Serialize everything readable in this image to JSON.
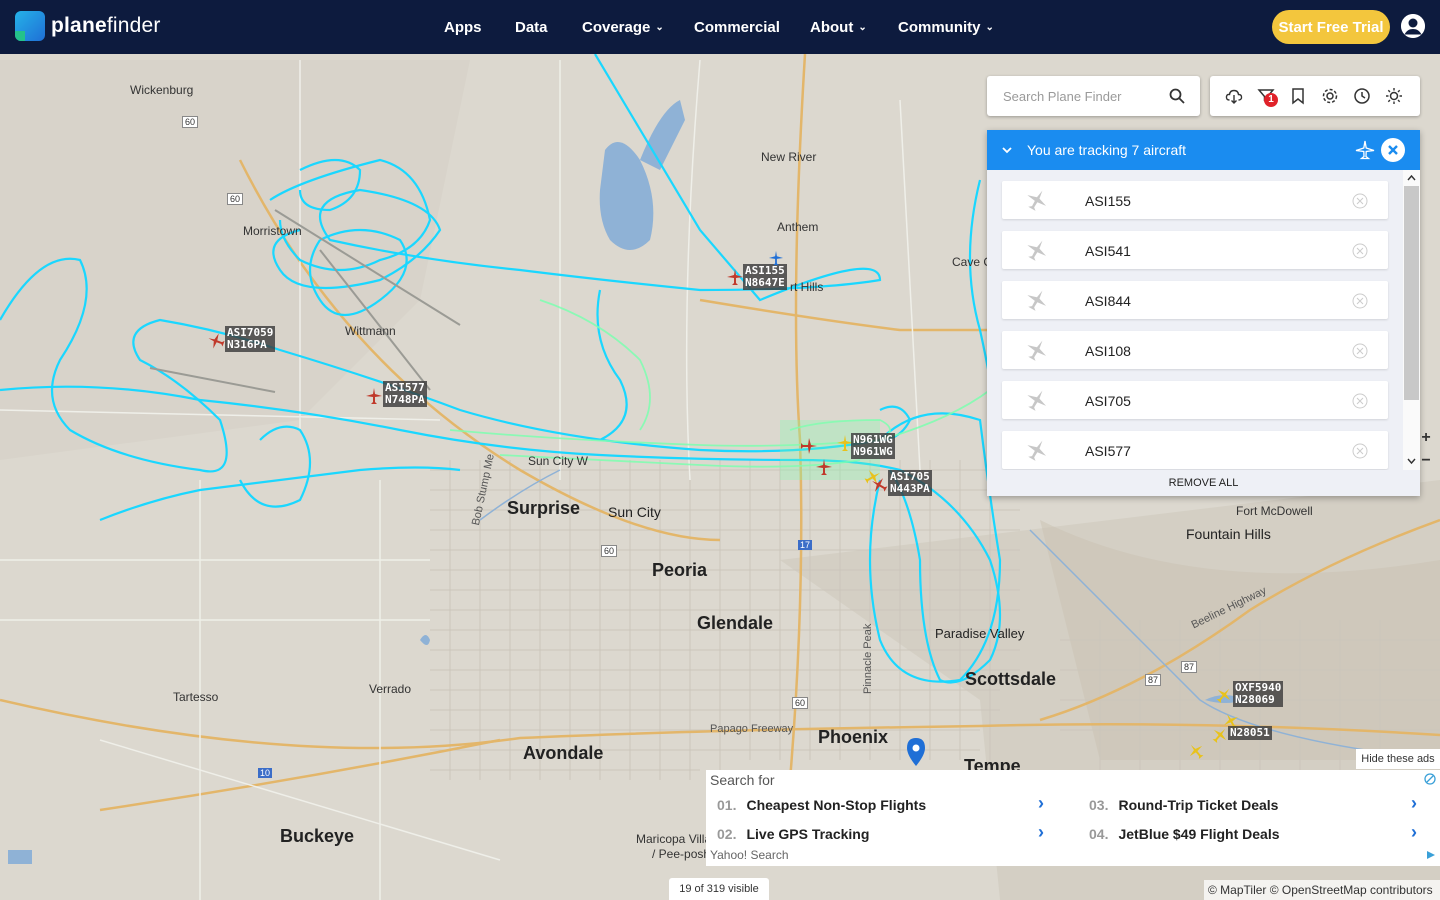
{
  "brand": {
    "name_bold": "plane",
    "name_rest": "finder"
  },
  "nav": {
    "apps": "Apps",
    "data": "Data",
    "coverage": "Coverage",
    "commercial": "Commercial",
    "about": "About",
    "community": "Community"
  },
  "cta": {
    "trial_label": "Start Free Trial"
  },
  "colors": {
    "topbar": "#0d1b3e",
    "accent": "#1a8cf0",
    "trial": "#f3c63d",
    "track_cyan": "#1ad7ff",
    "track_green": "#7dffb0"
  },
  "search": {
    "placeholder": "Search Plane Finder"
  },
  "toolbar": {
    "filter_badge": "1",
    "icons": [
      "cloud-icon",
      "filter-icon",
      "bookmark-icon",
      "settings-icon",
      "history-icon",
      "weather-icon"
    ]
  },
  "tracking": {
    "title": "You are tracking 7 aircraft",
    "items": [
      {
        "callsign": "ASI155"
      },
      {
        "callsign": "ASI541"
      },
      {
        "callsign": "ASI844"
      },
      {
        "callsign": "ASI108"
      },
      {
        "callsign": "ASI705"
      },
      {
        "callsign": "ASI577"
      }
    ],
    "remove_all": "REMOVE ALL"
  },
  "map": {
    "places": [
      {
        "name": "Wickenburg"
      },
      {
        "name": "Morristown"
      },
      {
        "name": "Wittmann"
      },
      {
        "name": "New River"
      },
      {
        "name": "Anthem"
      },
      {
        "name": "Cave C"
      },
      {
        "name": "rt Hills"
      },
      {
        "name": "Surprise"
      },
      {
        "name": "Sun City"
      },
      {
        "name": "Peoria"
      },
      {
        "name": "Glendale"
      },
      {
        "name": "Fort McDowell"
      },
      {
        "name": "Fountain Hills"
      },
      {
        "name": "Paradise Valley"
      },
      {
        "name": "Scottsdale"
      },
      {
        "name": "Phoenix"
      },
      {
        "name": "Tempe"
      },
      {
        "name": "Tartesso"
      },
      {
        "name": "Verrado"
      },
      {
        "name": "Avondale"
      },
      {
        "name": "Buckeye"
      },
      {
        "name": "Maricopa Villa"
      },
      {
        "name": "/ Pee-posh"
      },
      {
        "name": "Papago Freeway"
      },
      {
        "name": "Bob Stump Me"
      },
      {
        "name": "Beeline Highway"
      },
      {
        "name": "Pinnacle Peak"
      },
      {
        "name": "Sun City W"
      }
    ],
    "road_shields": [
      "60",
      "60",
      "17",
      "60",
      "87",
      "87",
      "10",
      "60"
    ],
    "aircraft_tags": [
      {
        "line1": "ASI155",
        "line2": "N8647E"
      },
      {
        "line1": "ASI7059",
        "line2": "N316PA"
      },
      {
        "line1": "ASI577",
        "line2": "N748PA"
      },
      {
        "line1": "N961WG",
        "line2": "N961WG"
      },
      {
        "line1": "ASI705",
        "line2": "N443PA"
      },
      {
        "line1": "OXF5940",
        "line2": "N28069"
      },
      {
        "line1": "N28051",
        "line2": ""
      }
    ],
    "visible_count": "19 of 319 visible",
    "attribution": "© MapTiler © OpenStreetMap contributors"
  },
  "ad": {
    "search_for": "Search for",
    "hide_ads": "Hide these ads",
    "items": [
      {
        "num": "01.",
        "label": "Cheapest Non-Stop Flights"
      },
      {
        "num": "02.",
        "label": "Live GPS Tracking"
      },
      {
        "num": "03.",
        "label": "Round-Trip Ticket Deals"
      },
      {
        "num": "04.",
        "label": "JetBlue $49 Flight Deals"
      }
    ],
    "provider": "Yahoo! Search"
  }
}
